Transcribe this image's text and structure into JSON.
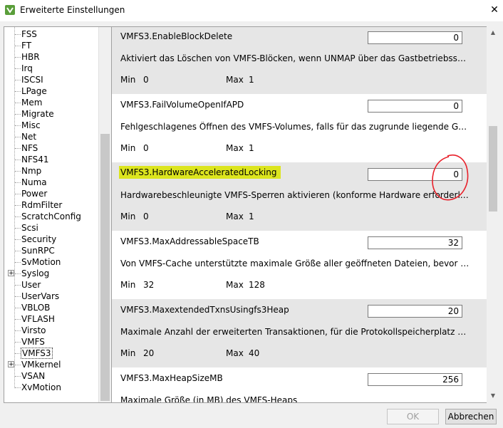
{
  "window": {
    "title": "Erweiterte Einstellungen",
    "close_glyph": "✕"
  },
  "tree": {
    "items": [
      {
        "label": "FSS",
        "expandable": false,
        "selected": false
      },
      {
        "label": "FT",
        "expandable": false,
        "selected": false
      },
      {
        "label": "HBR",
        "expandable": false,
        "selected": false
      },
      {
        "label": "Irq",
        "expandable": false,
        "selected": false
      },
      {
        "label": "ISCSI",
        "expandable": false,
        "selected": false
      },
      {
        "label": "LPage",
        "expandable": false,
        "selected": false
      },
      {
        "label": "Mem",
        "expandable": false,
        "selected": false
      },
      {
        "label": "Migrate",
        "expandable": false,
        "selected": false
      },
      {
        "label": "Misc",
        "expandable": false,
        "selected": false
      },
      {
        "label": "Net",
        "expandable": false,
        "selected": false
      },
      {
        "label": "NFS",
        "expandable": false,
        "selected": false
      },
      {
        "label": "NFS41",
        "expandable": false,
        "selected": false
      },
      {
        "label": "Nmp",
        "expandable": false,
        "selected": false
      },
      {
        "label": "Numa",
        "expandable": false,
        "selected": false
      },
      {
        "label": "Power",
        "expandable": false,
        "selected": false
      },
      {
        "label": "RdmFilter",
        "expandable": false,
        "selected": false
      },
      {
        "label": "ScratchConfig",
        "expandable": false,
        "selected": false
      },
      {
        "label": "Scsi",
        "expandable": false,
        "selected": false
      },
      {
        "label": "Security",
        "expandable": false,
        "selected": false
      },
      {
        "label": "SunRPC",
        "expandable": false,
        "selected": false
      },
      {
        "label": "SvMotion",
        "expandable": false,
        "selected": false
      },
      {
        "label": "Syslog",
        "expandable": true,
        "selected": false
      },
      {
        "label": "User",
        "expandable": false,
        "selected": false
      },
      {
        "label": "UserVars",
        "expandable": false,
        "selected": false
      },
      {
        "label": "VBLOB",
        "expandable": false,
        "selected": false
      },
      {
        "label": "VFLASH",
        "expandable": false,
        "selected": false
      },
      {
        "label": "Virsto",
        "expandable": false,
        "selected": false
      },
      {
        "label": "VMFS",
        "expandable": false,
        "selected": false
      },
      {
        "label": "VMFS3",
        "expandable": false,
        "selected": true
      },
      {
        "label": "VMkernel",
        "expandable": true,
        "selected": false
      },
      {
        "label": "VSAN",
        "expandable": false,
        "selected": false
      },
      {
        "label": "XvMotion",
        "expandable": false,
        "selected": false
      }
    ]
  },
  "settings": [
    {
      "name": "VMFS3.EnableBlockDelete",
      "value": "0",
      "description": "Aktiviert das Löschen von VMFS-Blöcken, wenn UNMAP über das Gastbetriebssystem ausgegeben wird",
      "min_label": "Min",
      "min": "0",
      "max_label": "Max",
      "max": "1",
      "highlighted": false
    },
    {
      "name": "VMFS3.FailVolumeOpenIfAPD",
      "value": "0",
      "description": "Fehlgeschlagenes Öffnen des VMFS-Volumes, falls für das zugrunde liegende Gerät ein APD vorliegt",
      "min_label": "Min",
      "min": "0",
      "max_label": "Max",
      "max": "1",
      "highlighted": false
    },
    {
      "name": "VMFS3.HardwareAcceleratedLocking",
      "value": "0",
      "description": "Hardwarebeschleunigte VMFS-Sperren aktivieren (konforme Hardware erforderlich). Lo",
      "min_label": "Min",
      "min": "0",
      "max_label": "Max",
      "max": "1",
      "highlighted": true
    },
    {
      "name": "VMFS3.MaxAddressableSpaceTB",
      "value": "32",
      "description": "Von VMFS-Cache unterstützte maximale Größe aller geöffneten Dateien, bevor Bereinigung",
      "min_label": "Min",
      "min": "32",
      "max_label": "Max",
      "max": "128",
      "highlighted": false
    },
    {
      "name": "VMFS3.MaxextendedTxnsUsingfs3Heap",
      "value": "20",
      "description": "Maximale Anzahl der erweiterten Transaktionen, für die Protokollspeicherplatz vom VMFS-Heap",
      "min_label": "Min",
      "min": "20",
      "max_label": "Max",
      "max": "40",
      "highlighted": false
    },
    {
      "name": "VMFS3.MaxHeapSizeMB",
      "value": "256",
      "description": "Maximale Größe (in MB) des VMFS-Heaps",
      "min_label": "Min",
      "min": "",
      "max_label": "Max",
      "max": "",
      "highlighted": false
    }
  ],
  "buttons": {
    "ok": "OK",
    "cancel": "Abbrechen"
  },
  "colors": {
    "highlight": "#dce51e",
    "annotation": "#e8202a",
    "alt_row": "#e6e6e6"
  }
}
